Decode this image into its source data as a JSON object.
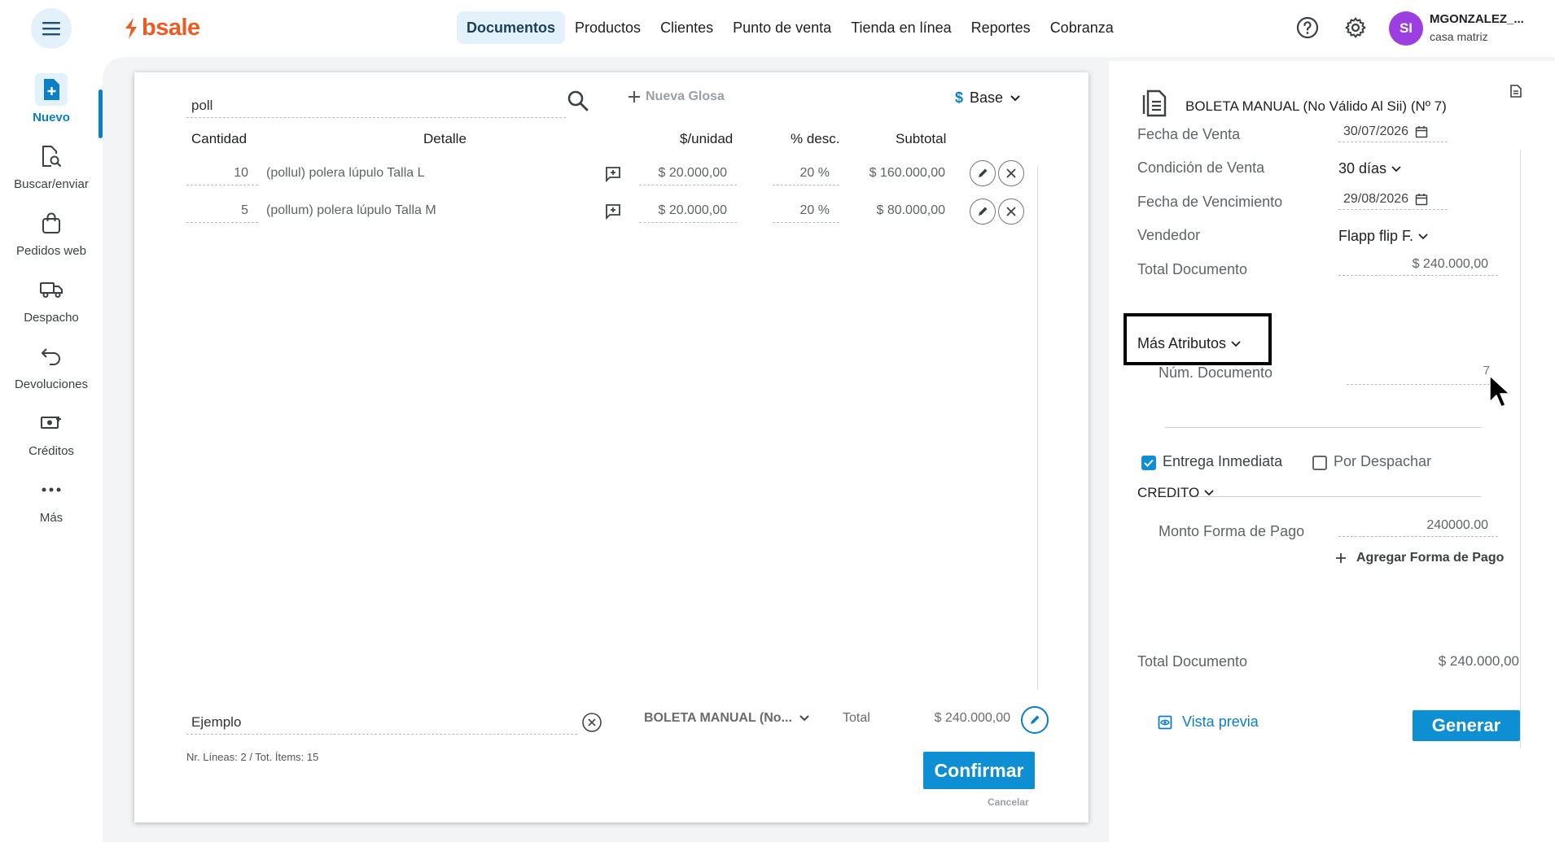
{
  "brand": {
    "logo_text": "bsale",
    "accent": "#0e8ed3",
    "logo_color": "#f05a22"
  },
  "nav": {
    "items": [
      {
        "label": "Documentos",
        "active": true
      },
      {
        "label": "Productos"
      },
      {
        "label": "Clientes"
      },
      {
        "label": "Punto de venta"
      },
      {
        "label": "Tienda en línea"
      },
      {
        "label": "Reportes"
      },
      {
        "label": "Cobranza"
      }
    ]
  },
  "user": {
    "initials": "SI",
    "name": "MGONZALEZ_...",
    "branch": "casa matriz"
  },
  "sidebar": {
    "items": [
      {
        "label": "Nuevo",
        "icon": "new-doc-icon",
        "active": true
      },
      {
        "label": "Buscar/enviar",
        "icon": "search-doc-icon"
      },
      {
        "label": "Pedidos web",
        "icon": "bag-icon"
      },
      {
        "label": "Despacho",
        "icon": "truck-icon"
      },
      {
        "label": "Devoluciones",
        "icon": "return-icon"
      },
      {
        "label": "Créditos",
        "icon": "money-icon"
      },
      {
        "label": "Más",
        "icon": "more-icon"
      }
    ]
  },
  "document": {
    "search_value": "poll",
    "nueva_glosa": "Nueva Glosa",
    "price_list": {
      "symbol": "$",
      "label": "Base"
    },
    "columns": {
      "qty": "Cantidad",
      "detail": "Detalle",
      "unit_price": "$/unidad",
      "discount": "% desc.",
      "subtotal": "Subtotal"
    },
    "rows": [
      {
        "qty": "10",
        "detail": "(pollul) polera lúpulo Talla L",
        "unit_price": "$ 20.000,00",
        "discount": "20 %",
        "subtotal": "$ 160.000,00"
      },
      {
        "qty": "5",
        "detail": "(pollum) polera lúpulo Talla M",
        "unit_price": "$ 20.000,00",
        "discount": "20 %",
        "subtotal": "$ 80.000,00"
      }
    ],
    "glosa_value": "Ejemplo",
    "doc_type": "BOLETA MANUAL (No...",
    "total_label": "Total",
    "total_value": "$ 240.000,00",
    "lines_info": "Nr. Líneas: 2 / Tot. Ítems: 15",
    "confirm_label": "Confirmar",
    "cancel_label": "Cancelar"
  },
  "panel": {
    "title": "BOLETA MANUAL (No Válido Al Sii) (Nº 7)",
    "fecha_venta": {
      "label": "Fecha de Venta",
      "value": "30/07/2026"
    },
    "condicion": {
      "label": "Condición de Venta",
      "value": "30 días"
    },
    "vencimiento": {
      "label": "Fecha de Vencimiento",
      "value": "29/08/2026"
    },
    "vendedor": {
      "label": "Vendedor",
      "value": "Flapp flip F."
    },
    "total_doc": {
      "label": "Total Documento",
      "value": "$ 240.000,00"
    },
    "mas_atributos": "Más Atributos",
    "num_documento": {
      "label": "Núm. Documento",
      "value": "7"
    },
    "entrega_inmediata": {
      "label": "Entrega Inmediata",
      "checked": true
    },
    "por_despachar": {
      "label": "Por Despachar",
      "checked": false
    },
    "credito": "CREDITO",
    "monto_pago": {
      "label": "Monto Forma de Pago",
      "value": "240000.00"
    },
    "agregar_pago": "Agregar Forma de Pago",
    "footer_total": {
      "label": "Total Documento",
      "value": "$ 240.000,00"
    },
    "vista_previa": "Vista previa",
    "generar": "Generar"
  }
}
